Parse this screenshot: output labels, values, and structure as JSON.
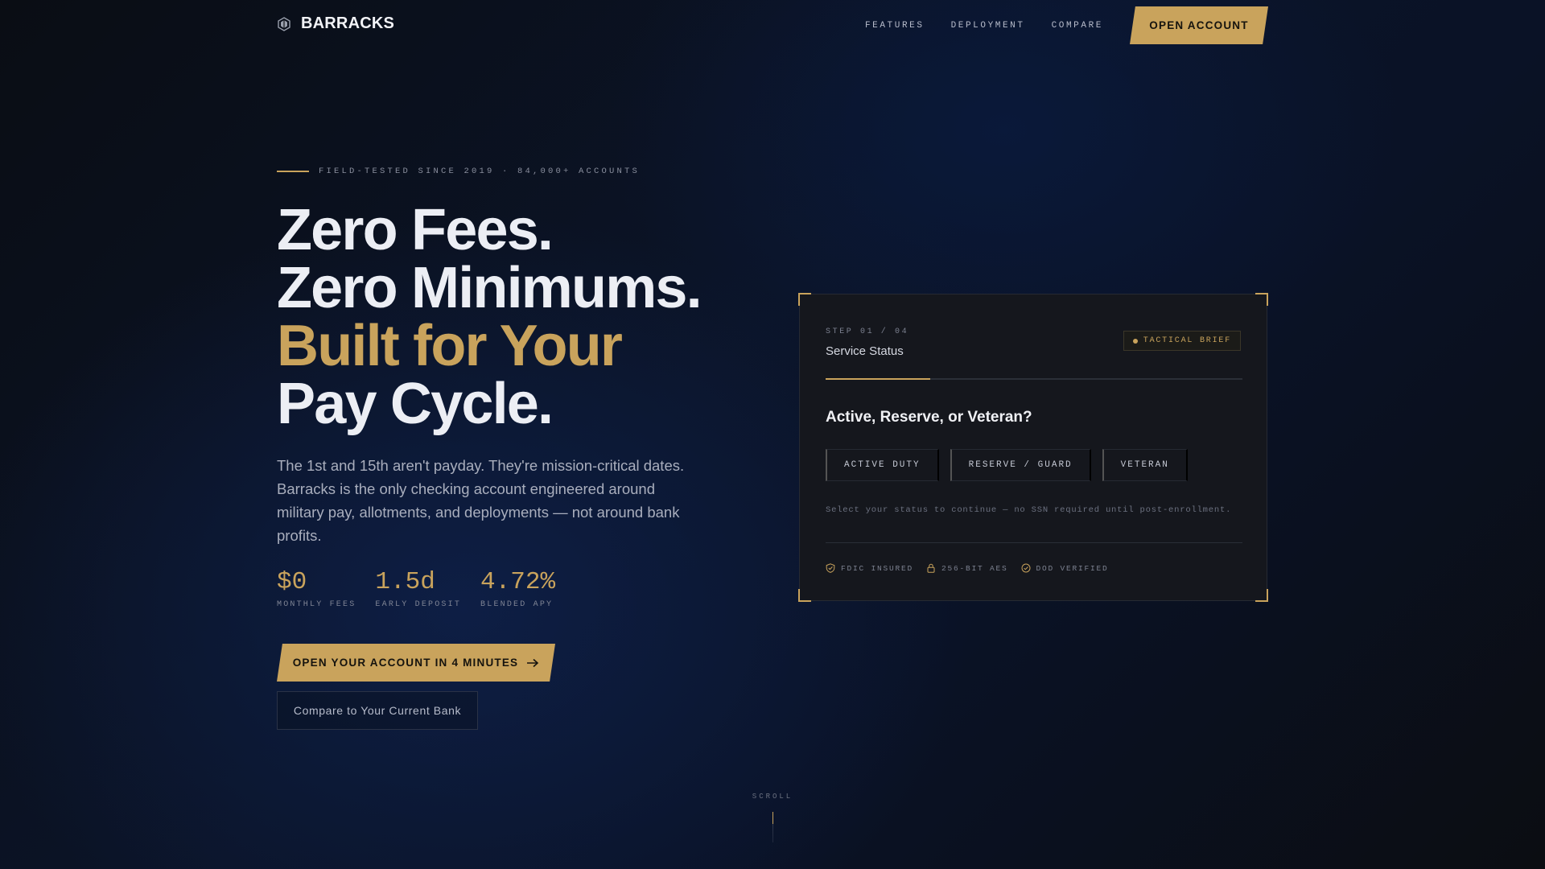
{
  "nav": {
    "brand": "BARRACKS",
    "links": [
      "FEATURES",
      "DEPLOYMENT",
      "COMPARE"
    ],
    "cta": "OPEN ACCOUNT"
  },
  "hero": {
    "eyebrow": "FIELD-TESTED SINCE 2019 · 84,000+ ACCOUNTS",
    "headline": {
      "line1": "Zero Fees.",
      "line2": "Zero Minimums.",
      "line3": "Built for Your",
      "line4": "Pay Cycle."
    },
    "lede": "The 1st and 15th aren't payday. They're mission-critical dates. Barracks is the only checking account engineered around military pay, allotments, and deployments — not around bank profits.",
    "stats": [
      {
        "value": "$0",
        "label": "MONTHLY FEES"
      },
      {
        "value": "1.5d",
        "label": "EARLY DEPOSIT"
      },
      {
        "value": "4.72%",
        "label": "BLENDED APY"
      }
    ],
    "cta_primary": "OPEN YOUR ACCOUNT IN 4 MINUTES",
    "cta_secondary": "Compare to Your Current Bank"
  },
  "card": {
    "step_label": "STEP 01 / 04",
    "step_title": "Service Status",
    "badge": "TACTICAL BRIEF",
    "progress_fraction": 0.25,
    "question": "Active, Reserve, or Veteran?",
    "options": [
      "ACTIVE DUTY",
      "RESERVE / GUARD",
      "VETERAN"
    ],
    "helper": "Select your status to continue — no SSN required until post-enrollment.",
    "trust": [
      {
        "icon": "shield-icon",
        "label": "FDIC INSURED"
      },
      {
        "icon": "lock-icon",
        "label": "256-BIT AES"
      },
      {
        "icon": "check-circle-icon",
        "label": "DOD VERIFIED"
      }
    ]
  },
  "scroll": {
    "label": "SCROLL"
  },
  "colors": {
    "accent": "#c9a35c",
    "background": "#0b1428",
    "card": "#15171d"
  }
}
